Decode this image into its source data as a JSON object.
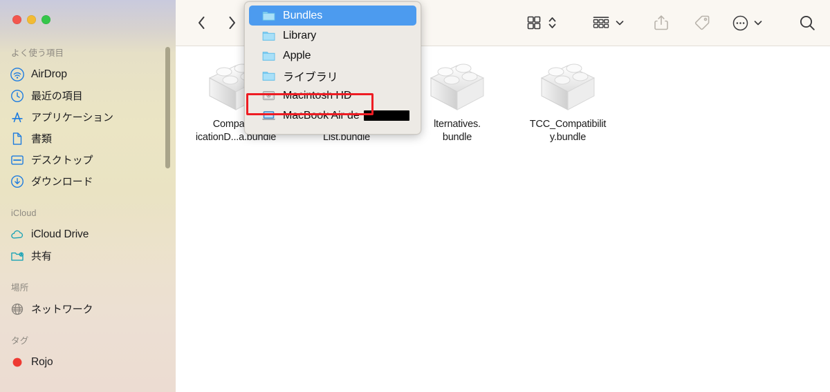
{
  "window": {
    "traffic_lights": [
      {
        "name": "close",
        "color": "#f2564e"
      },
      {
        "name": "minimize",
        "color": "#f2bb34"
      },
      {
        "name": "zoom",
        "color": "#35c64a"
      }
    ]
  },
  "sidebar": {
    "sections": [
      {
        "title": "よく使う項目",
        "items": [
          {
            "label": "AirDrop",
            "icon": "airdrop-icon",
            "color": "#1a7ae0"
          },
          {
            "label": "最近の項目",
            "icon": "clock-icon",
            "color": "#1a7ae0"
          },
          {
            "label": "アプリケーション",
            "icon": "applications-icon",
            "color": "#1a7ae0"
          },
          {
            "label": "書類",
            "icon": "document-icon",
            "color": "#1a7ae0"
          },
          {
            "label": "デスクトップ",
            "icon": "desktop-icon",
            "color": "#1a7ae0"
          },
          {
            "label": "ダウンロード",
            "icon": "download-icon",
            "color": "#1a7ae0"
          }
        ]
      },
      {
        "title": "iCloud",
        "items": [
          {
            "label": "iCloud Drive",
            "icon": "cloud-icon",
            "color": "#1aa3b5"
          },
          {
            "label": "共有",
            "icon": "shared-folder-icon",
            "color": "#1aa3b5"
          }
        ]
      },
      {
        "title": "場所",
        "items": [
          {
            "label": "ネットワーク",
            "icon": "globe-icon",
            "color": "#86817a"
          }
        ]
      },
      {
        "title": "タグ",
        "items": [
          {
            "label": "Rojo",
            "icon": "tag-dot-icon",
            "color": "#ee3a32"
          }
        ]
      }
    ]
  },
  "toolbar": {
    "back_label": "戻る",
    "forward_label": "進む",
    "view_icon": "grid-view-icon",
    "view_stepper_icon": "updown-chevron-icon",
    "group_icon": "group-by-icon",
    "group_chevron_icon": "chevron-down-icon",
    "share_icon": "share-icon",
    "tag_icon": "tag-icon",
    "more_icon": "ellipsis-circle-icon",
    "more_chevron_icon": "chevron-down-icon",
    "search_icon": "search-icon"
  },
  "files": [
    {
      "name_line1": "Compatibil",
      "name_line2": "icationD...a.bundle",
      "icon": "bundle-icon"
    },
    {
      "name_line1": "",
      "name_line2": "List.bundle",
      "icon": "bundle-icon"
    },
    {
      "name_line1": "lternatives.",
      "name_line2": "bundle",
      "icon": "bundle-icon"
    },
    {
      "name_line1": "TCC_Compatibilit",
      "name_line2": "y.bundle",
      "icon": "bundle-icon"
    }
  ],
  "dropdown": {
    "items": [
      {
        "label": "Bundles",
        "icon": "folder-icon",
        "selected": true,
        "redacted": false
      },
      {
        "label": "Library",
        "icon": "folder-icon",
        "selected": false,
        "redacted": false
      },
      {
        "label": "Apple",
        "icon": "folder-icon",
        "selected": false,
        "redacted": false
      },
      {
        "label": "ライブラリ",
        "icon": "folder-icon",
        "selected": false,
        "redacted": false
      },
      {
        "label": "Macintosh HD",
        "icon": "harddisk-icon",
        "selected": false,
        "redacted": false
      },
      {
        "label": "MacBook Air de",
        "icon": "laptop-icon",
        "selected": false,
        "redacted": true
      }
    ]
  },
  "annotation": {
    "highlight_color": "#ee1c23",
    "target_label": "Macintosh HD"
  }
}
